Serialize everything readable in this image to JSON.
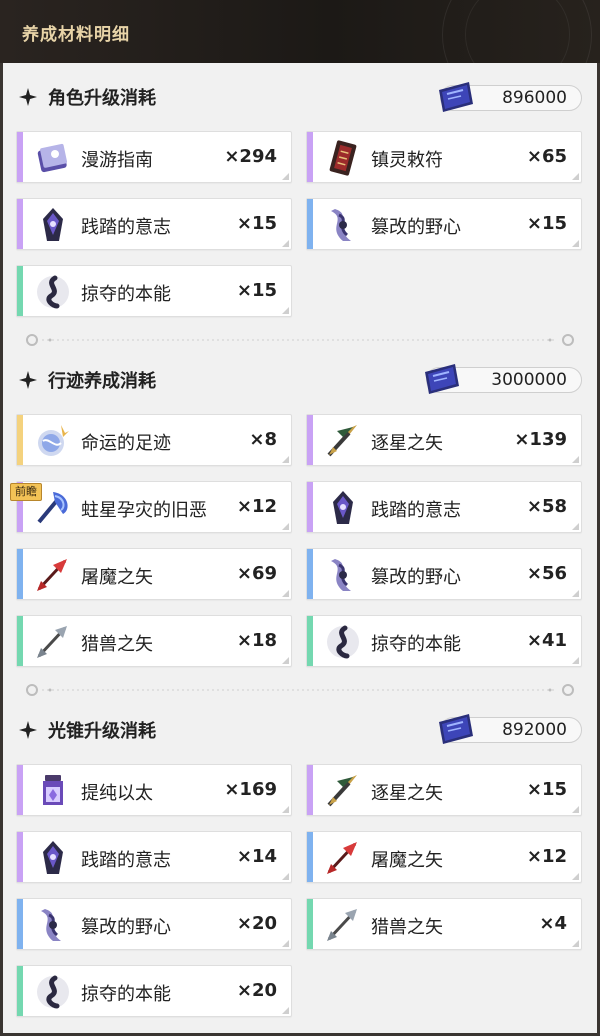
{
  "header": {
    "title": "养成材料明细"
  },
  "sections": [
    {
      "title": "角色升级消耗",
      "cost": "896000",
      "items": [
        {
          "name": "漫游指南",
          "qty": "×294",
          "rarity": "purple",
          "icon": "book-icon"
        },
        {
          "name": "镇灵敕符",
          "qty": "×65",
          "rarity": "purple",
          "icon": "talisman-icon"
        },
        {
          "name": "践踏的意志",
          "qty": "×15",
          "rarity": "purple",
          "icon": "dark-crystal-icon"
        },
        {
          "name": "篡改的野心",
          "qty": "×15",
          "rarity": "blue",
          "icon": "twisted-crystal-icon"
        },
        {
          "name": "掠夺的本能",
          "qty": "×15",
          "rarity": "green",
          "icon": "swirl-icon"
        }
      ]
    },
    {
      "title": "行迹养成消耗",
      "cost": "3000000",
      "badge": "前瞻",
      "items": [
        {
          "name": "命运的足迹",
          "qty": "×8",
          "rarity": "gold",
          "icon": "orb-icon"
        },
        {
          "name": "逐星之矢",
          "qty": "×139",
          "rarity": "purple",
          "icon": "golden-arrow-icon"
        },
        {
          "name": "蛀星孕灾的旧恶",
          "qty": "×12",
          "rarity": "purple",
          "icon": "axe-icon"
        },
        {
          "name": "践踏的意志",
          "qty": "×58",
          "rarity": "purple",
          "icon": "dark-crystal-icon"
        },
        {
          "name": "屠魔之矢",
          "qty": "×69",
          "rarity": "blue",
          "icon": "red-arrow-icon"
        },
        {
          "name": "篡改的野心",
          "qty": "×56",
          "rarity": "blue",
          "icon": "twisted-crystal-icon"
        },
        {
          "name": "猎兽之矢",
          "qty": "×18",
          "rarity": "green",
          "icon": "silver-arrow-icon"
        },
        {
          "name": "掠夺的本能",
          "qty": "×41",
          "rarity": "green",
          "icon": "swirl-icon"
        }
      ]
    },
    {
      "title": "光锥升级消耗",
      "cost": "892000",
      "items": [
        {
          "name": "提纯以太",
          "qty": "×169",
          "rarity": "purple",
          "icon": "ether-vial-icon"
        },
        {
          "name": "逐星之矢",
          "qty": "×15",
          "rarity": "purple",
          "icon": "golden-arrow-icon"
        },
        {
          "name": "践踏的意志",
          "qty": "×14",
          "rarity": "purple",
          "icon": "dark-crystal-icon"
        },
        {
          "name": "屠魔之矢",
          "qty": "×12",
          "rarity": "blue",
          "icon": "red-arrow-icon"
        },
        {
          "name": "篡改的野心",
          "qty": "×20",
          "rarity": "blue",
          "icon": "twisted-crystal-icon"
        },
        {
          "name": "猎兽之矢",
          "qty": "×4",
          "rarity": "green",
          "icon": "silver-arrow-icon"
        },
        {
          "name": "掠夺的本能",
          "qty": "×20",
          "rarity": "green",
          "icon": "swirl-icon"
        }
      ]
    }
  ],
  "colors": {
    "purple": "#c9a2f5",
    "blue": "#7fb2ef",
    "green": "#74d8b0",
    "gold": "#f4d27e",
    "header_bg": "#1c1916",
    "header_text": "#e8d4a8"
  }
}
